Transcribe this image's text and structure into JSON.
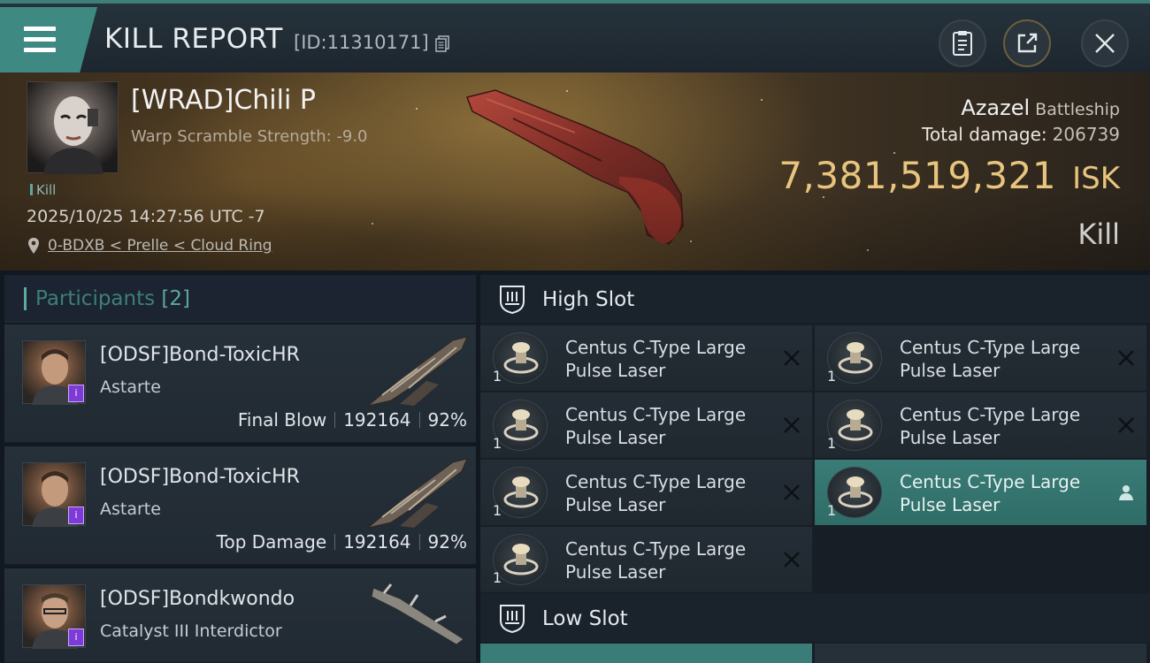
{
  "header": {
    "title": "KILL REPORT",
    "report_id": "[ID:11310171]",
    "icons": [
      "menu-icon",
      "copy-icon",
      "notes-icon",
      "share-icon",
      "close-icon"
    ]
  },
  "victim": {
    "name": "[WRAD]Chili P",
    "warp_scramble": "Warp Scramble Strength: -9.0",
    "tag": "Kill",
    "datetime": "2025/10/25 14:27:56 UTC -7",
    "location": "0-BDXB < Prelle < Cloud Ring",
    "ship_name": "Azazel",
    "ship_class": "Battleship",
    "total_damage_label": "Total damage:",
    "total_damage": "206739",
    "isk_value": "7,381,519,321",
    "isk_unit": "ISK",
    "result": "Kill"
  },
  "participants": {
    "label": "Participants",
    "count": "[2]",
    "items": [
      {
        "name": "[ODSF]Bond-ToxicHR",
        "ship": "Astarte",
        "role": "Final Blow",
        "damage": "192164",
        "percent": "92%"
      },
      {
        "name": "[ODSF]Bond-ToxicHR",
        "ship": "Astarte",
        "role": "Top Damage",
        "damage": "192164",
        "percent": "92%"
      },
      {
        "name": "[ODSF]Bondkwondo",
        "ship": "Catalyst III Interdictor"
      }
    ]
  },
  "fitting": {
    "high_slot_label": "High Slot",
    "low_slot_label": "Low Slot",
    "high_slot": [
      {
        "qty": "1",
        "name_line1": "Centus C-Type Large",
        "name_line2": "Pulse Laser",
        "state": "destroyed"
      },
      {
        "qty": "1",
        "name_line1": "Centus C-Type Large",
        "name_line2": "Pulse Laser",
        "state": "destroyed"
      },
      {
        "qty": "1",
        "name_line1": "Centus C-Type Large",
        "name_line2": "Pulse Laser",
        "state": "destroyed"
      },
      {
        "qty": "1",
        "name_line1": "Centus C-Type Large",
        "name_line2": "Pulse Laser",
        "state": "destroyed"
      },
      {
        "qty": "1",
        "name_line1": "Centus C-Type Large",
        "name_line2": "Pulse Laser",
        "state": "destroyed"
      },
      {
        "qty": "1",
        "name_line1": "Centus C-Type Large",
        "name_line2": "Pulse Laser",
        "state": "dropped"
      },
      {
        "qty": "1",
        "name_line1": "Centus C-Type Large",
        "name_line2": "Pulse Laser",
        "state": "destroyed"
      }
    ]
  },
  "colors": {
    "accent_teal": "#3e8a83",
    "isk_gold": "#e9c47e",
    "panel_bg": "#212a33",
    "corp_badge": "#7c3bd6"
  }
}
